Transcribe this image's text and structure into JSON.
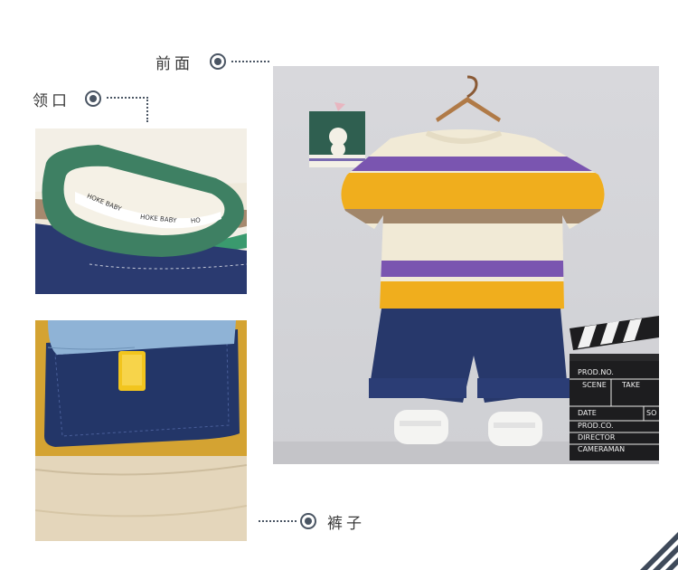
{
  "labels": {
    "front": "前面",
    "collar": "领口",
    "pants": "裤子"
  },
  "clapper": {
    "line1": "PROD.NO.",
    "scene": "SCENE",
    "take": "TAKE",
    "so": "SO",
    "date": "DATE",
    "prodco": "PROD.CO.",
    "director": "DIRECTOR",
    "cameraman": "CAMERAMAN"
  },
  "collar_text": {
    "t1": "HOKE BABY",
    "t2": "HOKE BABY",
    "t3": "HO"
  },
  "colors": {
    "accent": "#4a5563",
    "navy": "#26376a",
    "yellow": "#f1b01f",
    "purple": "#7d57b2",
    "cream": "#efe8d6",
    "brown": "#9a7f64",
    "green": "#3f8a6a"
  }
}
